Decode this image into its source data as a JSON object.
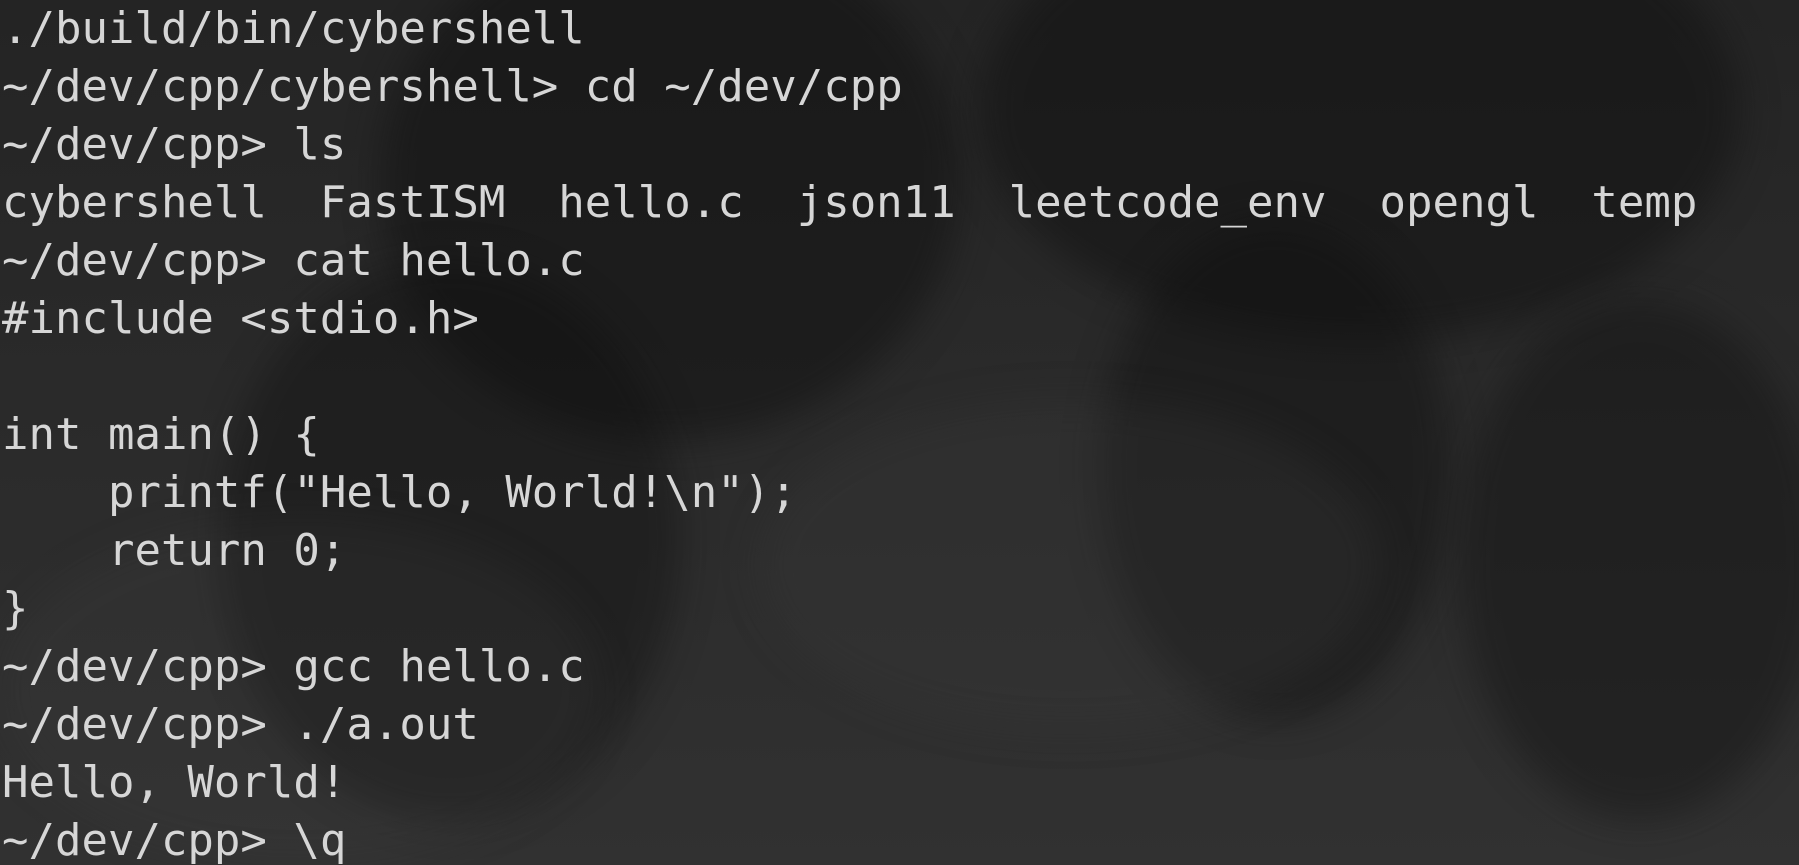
{
  "terminal": {
    "lines": [
      {
        "prompt": "",
        "text": "./build/bin/cybershell"
      },
      {
        "prompt": "~/dev/cpp/cybershell> ",
        "text": "cd ~/dev/cpp"
      },
      {
        "prompt": "~/dev/cpp> ",
        "text": "ls"
      },
      {
        "prompt": "",
        "text": "cybershell  FastISM  hello.c  json11  leetcode_env  opengl  temp"
      },
      {
        "prompt": "~/dev/cpp> ",
        "text": "cat hello.c"
      },
      {
        "prompt": "",
        "text": "#include <stdio.h>"
      },
      {
        "prompt": "",
        "text": ""
      },
      {
        "prompt": "",
        "text": "int main() {"
      },
      {
        "prompt": "",
        "text": "    printf(\"Hello, World!\\n\");"
      },
      {
        "prompt": "",
        "text": "    return 0;"
      },
      {
        "prompt": "",
        "text": "}"
      },
      {
        "prompt": "~/dev/cpp> ",
        "text": "gcc hello.c"
      },
      {
        "prompt": "~/dev/cpp> ",
        "text": "./a.out"
      },
      {
        "prompt": "",
        "text": "Hello, World!"
      },
      {
        "prompt": "~/dev/cpp> ",
        "text": "\\q"
      }
    ]
  },
  "colors": {
    "text": "#d6d6d6",
    "background": "#262626"
  }
}
